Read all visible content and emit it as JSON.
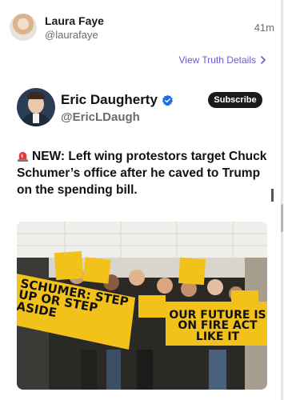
{
  "post": {
    "author_name": "Laura Faye",
    "author_handle": "@laurafaye",
    "time": "41m",
    "view_details_label": "View Truth Details"
  },
  "embed": {
    "name": "Eric Daugherty",
    "handle": "@EricLDaugh",
    "subscribe_label": "Subscribe",
    "text": "NEW: Left wing protestors target Chuck Schumer’s office after he caved to Trump on the spending bill."
  },
  "photo": {
    "banner_left": "SCHUMER: STEP UP OR STEP ASIDE",
    "banner_right": "OUR FUTURE IS ON FIRE ACT LIKE IT"
  },
  "colors": {
    "accent": "#6a5acd",
    "verified": "#1d6fe0",
    "siren": "#e23b3b",
    "banner_yellow": "#f2c21b"
  },
  "icons": {
    "verified": "verified-badge-icon",
    "siren": "siren-icon",
    "chevron": "chevron-right-icon"
  }
}
